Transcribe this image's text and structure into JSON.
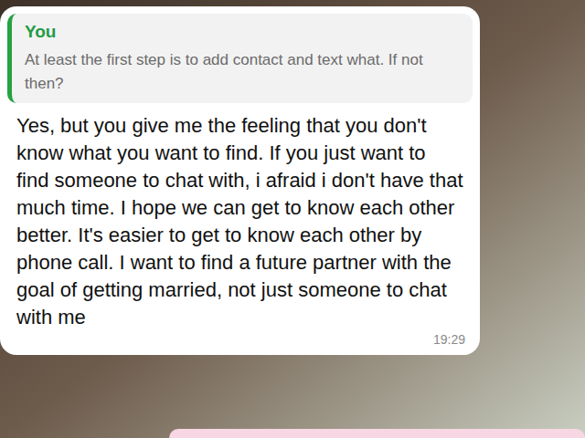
{
  "chat": {
    "message": {
      "quote": {
        "author": "You",
        "text": "At least the first step is to add contact and text what. If not then?"
      },
      "text": "Yes, but you give me the feeling that you don't know what you want to find. If you just want to find someone to chat with, i afraid i don't have that much time. I hope we can get to know each other better. It's easier to get to know each other by phone call. I want to find a future partner with the goal of getting married, not just someone to chat with me",
      "time": "19:29"
    }
  }
}
